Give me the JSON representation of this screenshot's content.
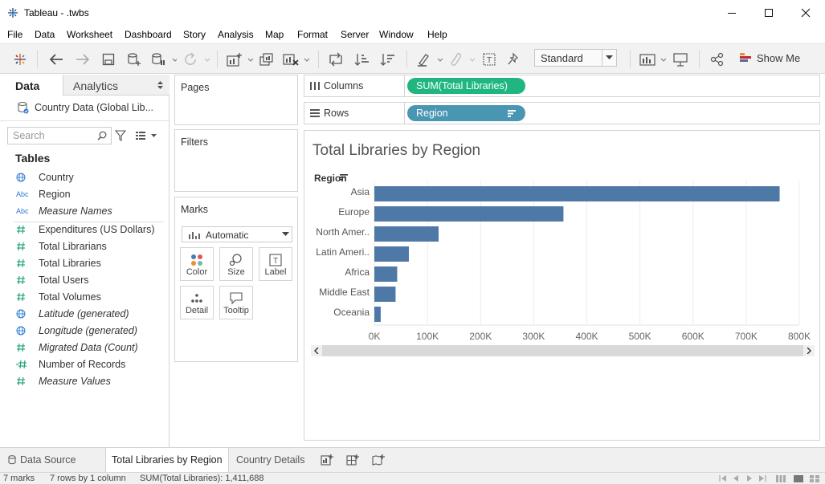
{
  "window": {
    "title": "Tableau - .twbs",
    "minimize_icon": "minimize-icon",
    "maximize_icon": "maximize-icon",
    "close_icon": "close-icon"
  },
  "menu": [
    "File",
    "Data",
    "Worksheet",
    "Dashboard",
    "Story",
    "Analysis",
    "Map",
    "Format",
    "Server",
    "Window",
    "Help"
  ],
  "toolbar": {
    "fit_option": "Standard",
    "show_me_label": "Show Me"
  },
  "data_pane": {
    "tabs": [
      "Data",
      "Analytics"
    ],
    "data_source": "Country Data (Global Lib...",
    "search_placeholder": "Search",
    "tables_heading": "Tables",
    "fields": [
      {
        "type": "geo",
        "name": "Country",
        "italic": false
      },
      {
        "type": "abc",
        "name": "Region",
        "italic": false
      },
      {
        "type": "abc",
        "name": "Measure Names",
        "italic": true
      },
      {
        "type": "measure",
        "name": "Expenditures  (US Dollars)",
        "italic": false
      },
      {
        "type": "measure",
        "name": "Total Librarians",
        "italic": false
      },
      {
        "type": "measure",
        "name": "Total Libraries",
        "italic": false
      },
      {
        "type": "measure",
        "name": "Total Users",
        "italic": false
      },
      {
        "type": "measure",
        "name": "Total Volumes",
        "italic": false
      },
      {
        "type": "geo",
        "name": "Latitude (generated)",
        "italic": true
      },
      {
        "type": "geo",
        "name": "Longitude (generated)",
        "italic": true
      },
      {
        "type": "measure",
        "name": "Migrated Data (Count)",
        "italic": true
      },
      {
        "type": "measure-calc",
        "name": "Number of Records",
        "italic": false
      },
      {
        "type": "measure",
        "name": "Measure Values",
        "italic": true
      }
    ]
  },
  "cards": {
    "pages": "Pages",
    "filters": "Filters",
    "marks": "Marks",
    "mark_type": "Automatic",
    "mark_buttons": [
      "Color",
      "Size",
      "Label",
      "Detail",
      "Tooltip"
    ]
  },
  "shelves": {
    "columns_label": "Columns",
    "columns_pill": "SUM(Total Libraries)",
    "rows_label": "Rows",
    "rows_pill": "Region",
    "measure_color": "#1fb77f",
    "dimension_color": "#4996b2"
  },
  "chart_data": {
    "type": "bar",
    "orientation": "horizontal",
    "title": "Total Libraries by Region",
    "row_header": "Region",
    "categories": [
      "Asia",
      "Europe",
      "North Amer..",
      "Latin Ameri..",
      "Africa",
      "Middle East",
      "Oceania"
    ],
    "values": [
      763000,
      356000,
      121000,
      65000,
      43000,
      40000,
      12000
    ],
    "xlim": [
      0,
      800000
    ],
    "x_ticks": [
      "0K",
      "100K",
      "200K",
      "300K",
      "400K",
      "500K",
      "600K",
      "700K",
      "800K"
    ],
    "bar_color": "#4e79a7",
    "grid": true
  },
  "sheet_tabs": {
    "data_source": "Data Source",
    "sheets": [
      "Total Libraries by Region",
      "Country Details"
    ],
    "active": "Total Libraries by Region"
  },
  "status": {
    "marks": "7 marks",
    "rows_cols": "7 rows by 1 column",
    "sum": "SUM(Total Libraries): 1,411,688"
  }
}
